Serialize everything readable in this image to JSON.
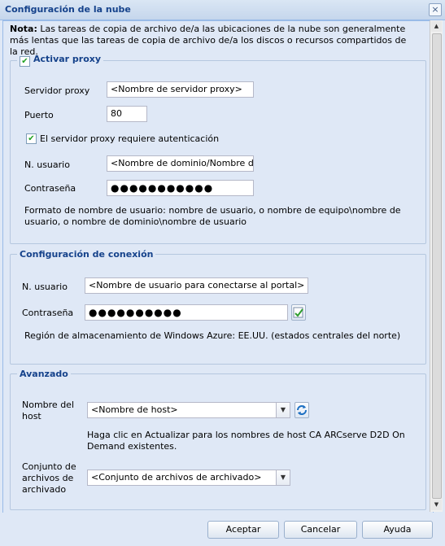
{
  "window": {
    "title": "Configuración de la nube",
    "close_label": "×"
  },
  "note": {
    "bold": "Nota:",
    "text": " Las tareas de copia de archivo de/a las ubicaciones de la nube son generalmente más lentas que las tareas de copia de archivo de/a los discos o recursos compartidos de la red."
  },
  "proxy": {
    "legend": "Activar proxy",
    "enabled": true,
    "server_label": "Servidor proxy",
    "server_value": "<Nombre de servidor proxy>",
    "port_label": "Puerto",
    "port_value": "80",
    "auth_label": "El servidor proxy requiere autenticación",
    "auth_enabled": true,
    "user_label": "N. usuario",
    "user_value": "<Nombre de dominio/Nombre de usuario>",
    "password_label": "Contraseña",
    "password_value": "●●●●●●●●●●●",
    "format_text": "Formato de nombre de usuario: nombre de usuario, o nombre de equipo\\nombre de usuario, o nombre de dominio\\nombre de usuario"
  },
  "connection": {
    "legend": "Configuración de conexión",
    "user_label": "N. usuario",
    "user_value": "<Nombre de usuario para conectarse al portal>",
    "password_label": "Contraseña",
    "password_value": "●●●●●●●●●●",
    "region_text": "Región de almacenamiento de Windows Azure: EE.UU. (estados centrales del norte)"
  },
  "advanced": {
    "legend": "Avanzado",
    "host_label": "Nombre del host",
    "host_value": "<Nombre de host>",
    "host_hint": "Haga clic en Actualizar para los nombres de host CA ARCserve D2D On Demand existentes.",
    "archive_label": "Conjunto de archivos de archivado",
    "archive_value": "<Conjunto de archivos de archivado>"
  },
  "buttons": {
    "accept": "Aceptar",
    "cancel": "Cancelar",
    "help": "Ayuda"
  },
  "icons": {
    "check": "✔",
    "dropdown": "▼",
    "scroll_up": "▲",
    "scroll_down": "▼"
  },
  "colors": {
    "accent": "#15428b",
    "border": "#99bbe8",
    "background": "#dfe8f6"
  }
}
